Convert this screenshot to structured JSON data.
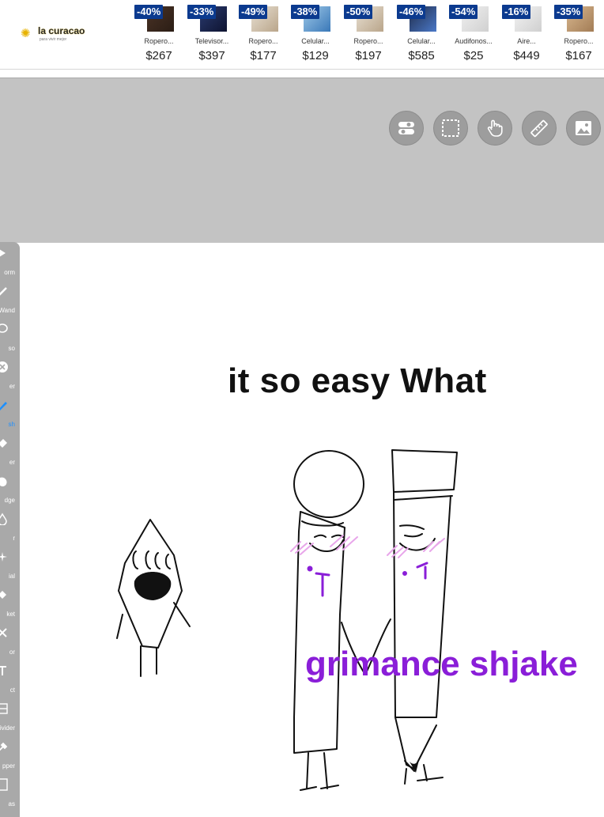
{
  "ad": {
    "logo": {
      "brand": "la curacao",
      "tagline": "para vivir mejor"
    },
    "products": [
      {
        "discount": "-40%",
        "name": "Ropero...",
        "price": "$267",
        "thumb": "wardrobe-dark"
      },
      {
        "discount": "-33%",
        "name": "Televisor...",
        "price": "$397",
        "thumb": "tv"
      },
      {
        "discount": "-49%",
        "name": "Ropero...",
        "price": "$177",
        "thumb": "wardrobe-light"
      },
      {
        "discount": "-38%",
        "name": "Celular...",
        "price": "$129",
        "thumb": "phone-blue"
      },
      {
        "discount": "-50%",
        "name": "Ropero...",
        "price": "$197",
        "thumb": "wardrobe-light"
      },
      {
        "discount": "-46%",
        "name": "Celular...",
        "price": "$585",
        "thumb": "phone-dark"
      },
      {
        "discount": "-54%",
        "name": "Audifonos...",
        "price": "$25",
        "thumb": "headphones"
      },
      {
        "discount": "-16%",
        "name": "Aire...",
        "price": "$449",
        "thumb": "air-conditioner"
      },
      {
        "discount": "-35%",
        "name": "Ropero...",
        "price": "$167",
        "thumb": "wardrobe-wood"
      }
    ]
  },
  "toolbar_buttons": [
    {
      "name": "toggle-button",
      "icon": "toggle-icon"
    },
    {
      "name": "selection-button",
      "icon": "selection-icon"
    },
    {
      "name": "touch-button",
      "icon": "hand-touch-icon"
    },
    {
      "name": "ruler-button",
      "icon": "ruler-icon"
    },
    {
      "name": "image-button",
      "icon": "image-icon"
    }
  ],
  "tool_panel": {
    "items": [
      {
        "label": "Transform",
        "visible_label": "orm",
        "icon": "transform-icon",
        "active": false
      },
      {
        "label": "Magic Wand",
        "visible_label": "Wand",
        "icon": "magic-wand-icon",
        "active": false
      },
      {
        "label": "Lasso",
        "visible_label": "so",
        "icon": "lasso-icon",
        "active": false
      },
      {
        "label": "Filter",
        "visible_label": "er",
        "icon": "filter-icon",
        "active": false
      },
      {
        "label": "Brush",
        "visible_label": "sh",
        "icon": "brush-icon",
        "active": true
      },
      {
        "label": "Eraser",
        "visible_label": "er",
        "icon": "eraser-icon",
        "active": false
      },
      {
        "label": "Smudge",
        "visible_label": "dge",
        "icon": "smudge-icon",
        "active": false
      },
      {
        "label": "Blur",
        "visible_label": "r",
        "icon": "blur-icon",
        "active": false
      },
      {
        "label": "Special",
        "visible_label": "ial",
        "icon": "special-icon",
        "active": false
      },
      {
        "label": "Bucket",
        "visible_label": "ket",
        "icon": "bucket-icon",
        "active": false
      },
      {
        "label": "Color",
        "visible_label": "or",
        "icon": "color-icon",
        "active": false
      },
      {
        "label": "Text",
        "visible_label": "ct",
        "icon": "text-icon",
        "active": false
      },
      {
        "label": "Frame Divider",
        "visible_label": "ivider",
        "icon": "frame-divider-icon",
        "active": false
      },
      {
        "label": "Eyedropper",
        "visible_label": "pper",
        "icon": "eyedropper-icon",
        "active": false
      },
      {
        "label": "Canvas",
        "visible_label": "as",
        "icon": "canvas-icon",
        "active": false
      }
    ]
  },
  "canvas": {
    "caption_top": "it so easy What",
    "caption_purple": "grimance shjake"
  },
  "colors": {
    "discount_badge": "#0b3a8f",
    "gray_area": "#c3c3c3",
    "tool_panel": "#a9a9a9",
    "active_tool": "#1e90ff",
    "purple_text": "#8a1ed8"
  }
}
